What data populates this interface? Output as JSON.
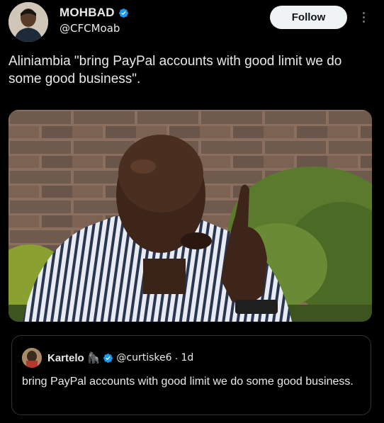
{
  "post": {
    "display_name": "MOHBAD",
    "handle": "@CFCMoab",
    "follow_label": "Follow",
    "text": "Aliniambia \"bring PayPal accounts with good limit we do some good business\"."
  },
  "quoted": {
    "display_name": "Kartelo",
    "emoji": "🦍",
    "handle": "@curtiske6",
    "separator": "·",
    "time": "1d",
    "text": "bring PayPal accounts with good limit we do some good business."
  },
  "colors": {
    "background": "#000000",
    "verified": "#1d9bf0",
    "follow_bg": "#eff3f4"
  },
  "icons": [
    "verified-badge-icon",
    "more-options-icon"
  ]
}
